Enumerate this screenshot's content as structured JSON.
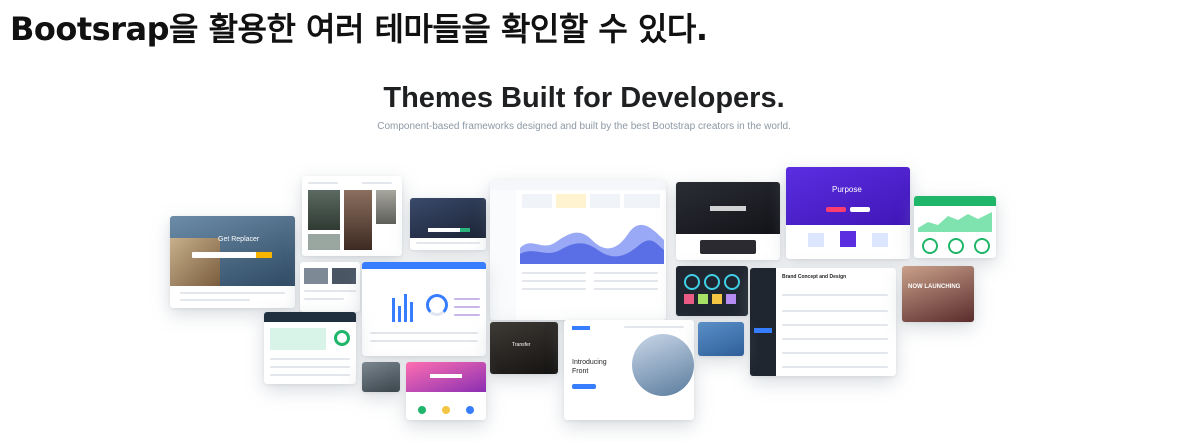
{
  "heading": "Bootsrap을 활용한 여러 테마들을 확인할 수 있다.",
  "hero": {
    "title": "Themes Built for Developers.",
    "subtitle": "Component-based frameworks designed and built by the best Bootstrap creators in the world."
  },
  "thumbnails": {
    "replacer": "Get Replacer",
    "purpose": "Purpose",
    "front": "Introducing Front",
    "brand": "Brand Concept and Design",
    "nowlaunch": "NOW LAUNCHING",
    "transfer": "Transfer"
  },
  "colors": {
    "purple": "#5b2ee0",
    "green": "#1fb66a",
    "blue": "#377dff",
    "dark": "#1f2630"
  }
}
